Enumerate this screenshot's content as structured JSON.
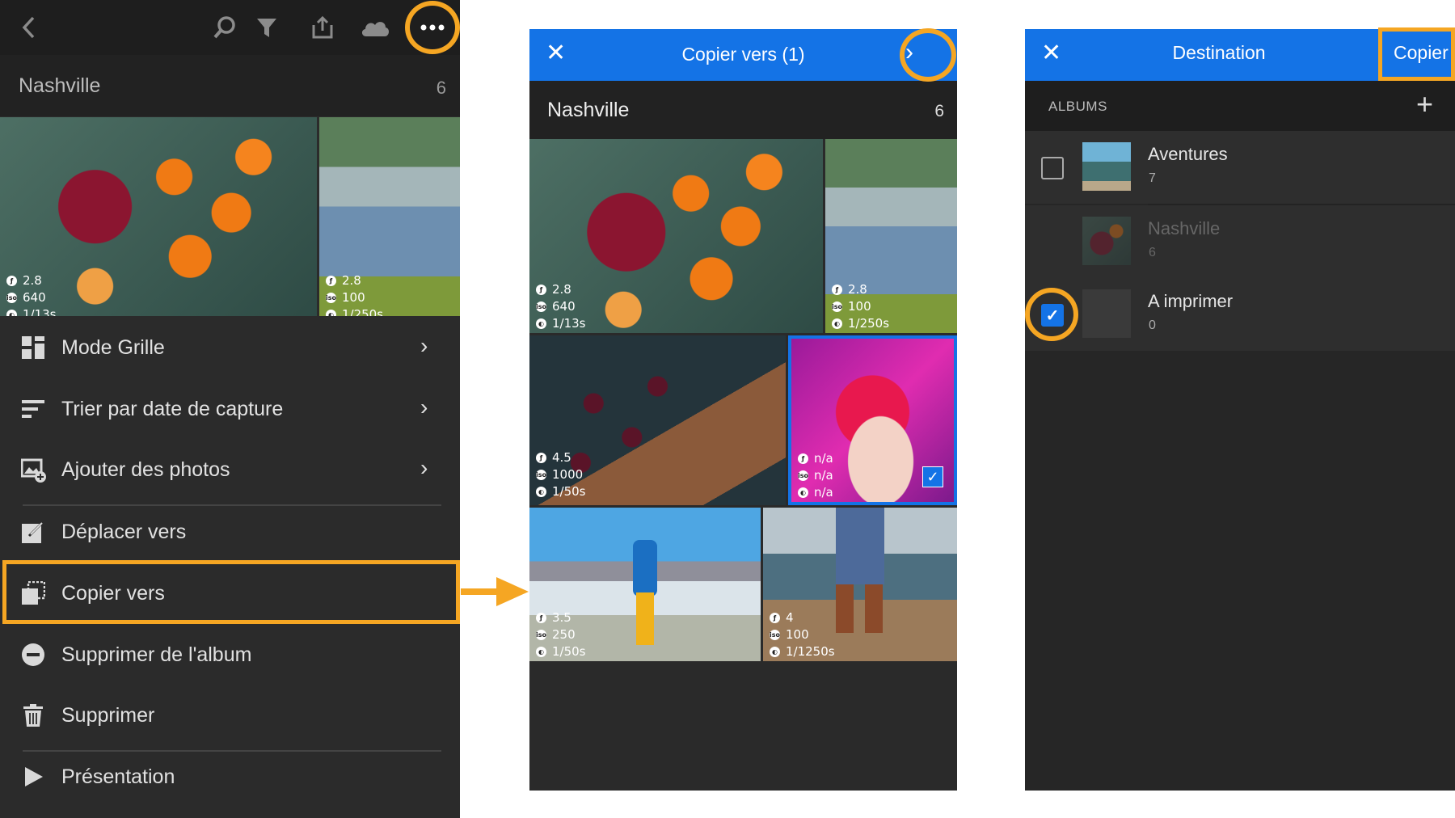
{
  "colors": {
    "accent": "#f5a623",
    "header_blue": "#1473e6",
    "dark_bg": "#2b2b2b"
  },
  "panel1": {
    "toolbar_icons": [
      "back-icon",
      "search-icon",
      "filter-icon",
      "share-icon",
      "cloud-icon",
      "more-icon"
    ],
    "album": {
      "title": "Nashville",
      "count": "6"
    },
    "photos": [
      {
        "aperture": "2.8",
        "iso": "640",
        "shutter": "1/13s"
      },
      {
        "aperture": "2.8",
        "iso": "100",
        "shutter": "1/250s"
      }
    ],
    "menu": [
      {
        "label": "Mode Grille",
        "icon": "grid-icon",
        "chevron": true
      },
      {
        "label": "Trier par date de capture",
        "icon": "sort-icon",
        "chevron": true
      },
      {
        "label": "Ajouter des photos",
        "icon": "add-photo-icon",
        "chevron": true
      },
      {
        "label": "Déplacer vers",
        "icon": "move-icon",
        "chevron": false
      },
      {
        "label": "Copier vers",
        "icon": "copy-icon",
        "chevron": false
      },
      {
        "label": "Supprimer de l'album",
        "icon": "minus-circle-icon",
        "chevron": false
      },
      {
        "label": "Supprimer",
        "icon": "trash-icon",
        "chevron": false
      },
      {
        "label": "Présentation",
        "icon": "play-icon",
        "chevron": false
      }
    ]
  },
  "panel2": {
    "header": {
      "title": "Copier vers (1)"
    },
    "album": {
      "title": "Nashville",
      "count": "6"
    },
    "photos": [
      {
        "aperture": "2.8",
        "iso": "640",
        "shutter": "1/13s"
      },
      {
        "aperture": "2.8",
        "iso": "100",
        "shutter": "1/250s"
      },
      {
        "aperture": "4.5",
        "iso": "1000",
        "shutter": "1/50s"
      },
      {
        "aperture": "n/a",
        "iso": "n/a",
        "shutter": "n/a",
        "selected": true
      },
      {
        "aperture": "3.5",
        "iso": "250",
        "shutter": "1/50s"
      },
      {
        "aperture": "4",
        "iso": "100",
        "shutter": "1/1250s"
      }
    ]
  },
  "panel3": {
    "header": {
      "title": "Destination",
      "action": "Copier"
    },
    "section_label": "ALBUMS",
    "albums": [
      {
        "name": "Aventures",
        "count": "7",
        "checked": false,
        "disabled": false
      },
      {
        "name": "Nashville",
        "count": "6",
        "checked": false,
        "disabled": true
      },
      {
        "name": "A imprimer",
        "count": "0",
        "checked": true,
        "disabled": false
      }
    ]
  }
}
